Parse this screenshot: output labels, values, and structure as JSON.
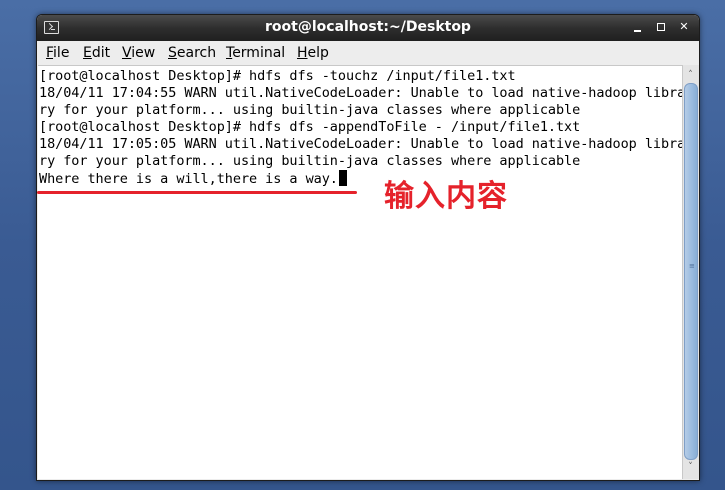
{
  "window": {
    "title": "root@localhost:~/Desktop",
    "controls": {
      "minimize_icon": "minimize-icon",
      "maximize_icon": "maximize-icon",
      "close_label": "✕"
    }
  },
  "menubar": {
    "items": [
      {
        "key": "F",
        "rest": "ile"
      },
      {
        "key": "E",
        "rest": "dit"
      },
      {
        "key": "V",
        "rest": "iew"
      },
      {
        "key": "S",
        "rest": "earch"
      },
      {
        "key": "T",
        "rest": "erminal"
      },
      {
        "key": "H",
        "rest": "elp"
      }
    ]
  },
  "terminal": {
    "lines": [
      "[root@localhost Desktop]# hdfs dfs -touchz /input/file1.txt",
      "18/04/11 17:04:55 WARN util.NativeCodeLoader: Unable to load native-hadoop libra",
      "ry for your platform... using builtin-java classes where applicable",
      "[root@localhost Desktop]# hdfs dfs -appendToFile - /input/file1.txt",
      "18/04/11 17:05:05 WARN util.NativeCodeLoader: Unable to load native-hadoop libra",
      "ry for your platform... using builtin-java classes where applicable",
      "Where there is a will,there is a way."
    ]
  },
  "scrollbar": {
    "up_arrow": "˄",
    "down_arrow": "˅",
    "grip": "≡"
  },
  "annotation": {
    "text": "输入内容",
    "color": "#e5222b"
  }
}
